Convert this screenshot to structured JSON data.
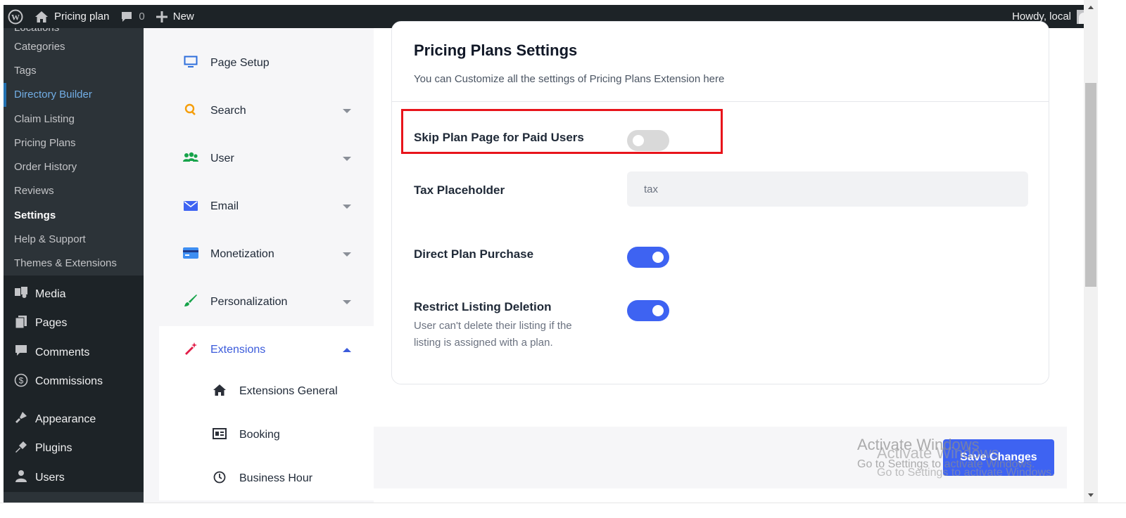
{
  "adminbar": {
    "site_name": "Pricing plan",
    "comments_count": "0",
    "new_label": "New",
    "howdy": "Howdy, local"
  },
  "wp_menu": {
    "submenu": [
      "Locations",
      "Categories",
      "Tags",
      "Directory Builder",
      "Claim Listing",
      "Pricing Plans",
      "Order History",
      "Reviews",
      "Settings",
      "Help & Support",
      "Themes & Extensions"
    ],
    "current_submenu": "Directory Builder",
    "bold_submenu": "Settings",
    "main": [
      {
        "label": "Media",
        "icon": "media-icon"
      },
      {
        "label": "Pages",
        "icon": "pages-icon"
      },
      {
        "label": "Comments",
        "icon": "comments-icon"
      },
      {
        "label": "Commissions",
        "icon": "dollar-icon"
      },
      {
        "label": "Appearance",
        "icon": "appearance-icon"
      },
      {
        "label": "Plugins",
        "icon": "plugins-icon"
      },
      {
        "label": "Users",
        "icon": "users-icon"
      }
    ]
  },
  "settings_nav": {
    "items": [
      {
        "label": "Page Setup",
        "icon": "monitor-icon",
        "has_caret": false
      },
      {
        "label": "Search",
        "icon": "search-icon",
        "has_caret": true
      },
      {
        "label": "User",
        "icon": "user-group-icon",
        "has_caret": true
      },
      {
        "label": "Email",
        "icon": "envelope-icon",
        "has_caret": true
      },
      {
        "label": "Monetization",
        "icon": "credit-card-icon",
        "has_caret": true
      },
      {
        "label": "Personalization",
        "icon": "brush-icon",
        "has_caret": true
      },
      {
        "label": "Extensions",
        "icon": "magic-wand-icon",
        "has_caret": true,
        "expanded": true
      }
    ],
    "sub_items": [
      {
        "label": "Extensions General",
        "icon": "home-icon"
      },
      {
        "label": "Booking",
        "icon": "id-card-icon"
      },
      {
        "label": "Business Hour",
        "icon": "clock-icon"
      }
    ]
  },
  "panel": {
    "title": "Pricing Plans Settings",
    "description": "You can Customize all the settings of Pricing Plans Extension here",
    "skip_plan": {
      "label": "Skip Plan Page for Paid Users",
      "enabled": false
    },
    "tax": {
      "label": "Tax Placeholder",
      "value": "tax"
    },
    "direct_purchase": {
      "label": "Direct Plan Purchase",
      "enabled": true
    },
    "restrict_deletion": {
      "label": "Restrict Listing Deletion",
      "enabled": true,
      "help": "User can't delete their listing if the listing is assigned with a plan."
    }
  },
  "footer": {
    "save_label": "Save Changes"
  },
  "watermark": {
    "line1": "Activate Windows",
    "line2": "Go to Settings to activate Windows."
  },
  "colors": {
    "accent": "#3e63f2",
    "highlight": "#e8141b",
    "admin_bar": "#1d2327",
    "sidebar": "#2c3338"
  }
}
